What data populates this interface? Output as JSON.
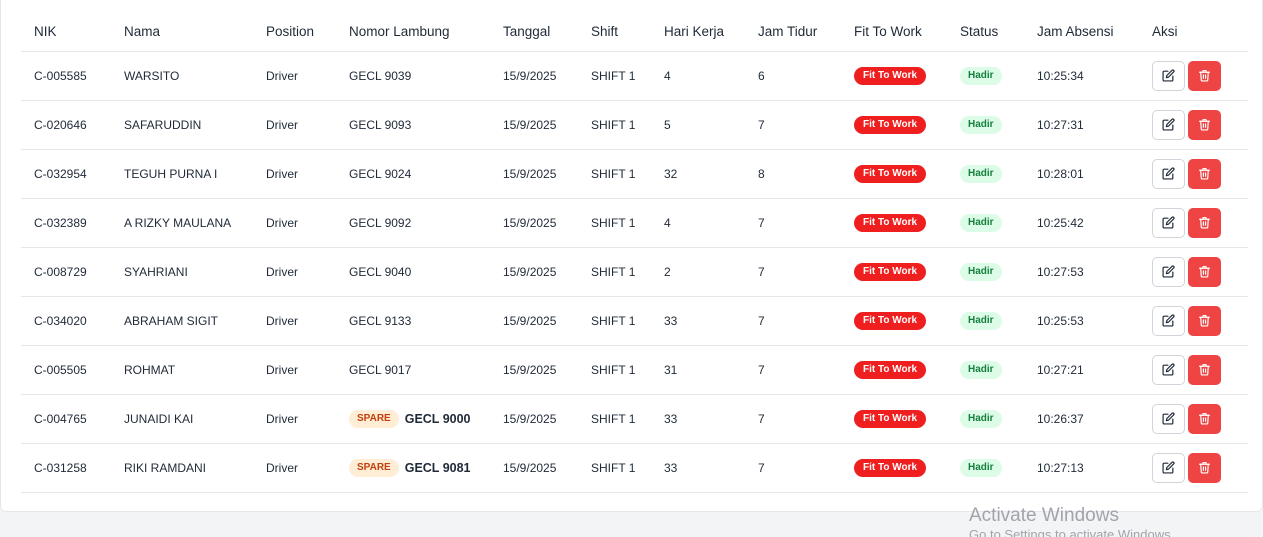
{
  "table": {
    "headers": [
      "NIK",
      "Nama",
      "Position",
      "Nomor Lambung",
      "Tanggal",
      "Shift",
      "Hari Kerja",
      "Jam Tidur",
      "Fit To Work",
      "Status",
      "Jam Absensi",
      "Aksi"
    ],
    "rows": [
      {
        "nik": "C-005585",
        "nama": "WARSITO",
        "position": "Driver",
        "spare": "",
        "lambung": "GECL 9039",
        "tanggal": "15/9/2025",
        "shift": "SHIFT 1",
        "hari_kerja": "4",
        "jam_tidur": "6",
        "fit": "Fit To Work",
        "status": "Hadir",
        "jam_absensi": "10:25:34"
      },
      {
        "nik": "C-020646",
        "nama": "SAFARUDDIN",
        "position": "Driver",
        "spare": "",
        "lambung": "GECL 9093",
        "tanggal": "15/9/2025",
        "shift": "SHIFT 1",
        "hari_kerja": "5",
        "jam_tidur": "7",
        "fit": "Fit To Work",
        "status": "Hadir",
        "jam_absensi": "10:27:31"
      },
      {
        "nik": "C-032954",
        "nama": "TEGUH PURNA I",
        "position": "Driver",
        "spare": "",
        "lambung": "GECL 9024",
        "tanggal": "15/9/2025",
        "shift": "SHIFT 1",
        "hari_kerja": "32",
        "jam_tidur": "8",
        "fit": "Fit To Work",
        "status": "Hadir",
        "jam_absensi": "10:28:01"
      },
      {
        "nik": "C-032389",
        "nama": "A RIZKY MAULANA",
        "position": "Driver",
        "spare": "",
        "lambung": "GECL 9092",
        "tanggal": "15/9/2025",
        "shift": "SHIFT 1",
        "hari_kerja": "4",
        "jam_tidur": "7",
        "fit": "Fit To Work",
        "status": "Hadir",
        "jam_absensi": "10:25:42"
      },
      {
        "nik": "C-008729",
        "nama": "SYAHRIANI",
        "position": "Driver",
        "spare": "",
        "lambung": "GECL 9040",
        "tanggal": "15/9/2025",
        "shift": "SHIFT 1",
        "hari_kerja": "2",
        "jam_tidur": "7",
        "fit": "Fit To Work",
        "status": "Hadir",
        "jam_absensi": "10:27:53"
      },
      {
        "nik": "C-034020",
        "nama": "ABRAHAM SIGIT",
        "position": "Driver",
        "spare": "",
        "lambung": "GECL 9133",
        "tanggal": "15/9/2025",
        "shift": "SHIFT 1",
        "hari_kerja": "33",
        "jam_tidur": "7",
        "fit": "Fit To Work",
        "status": "Hadir",
        "jam_absensi": "10:25:53"
      },
      {
        "nik": "C-005505",
        "nama": "ROHMAT",
        "position": "Driver",
        "spare": "",
        "lambung": "GECL 9017",
        "tanggal": "15/9/2025",
        "shift": "SHIFT 1",
        "hari_kerja": "31",
        "jam_tidur": "7",
        "fit": "Fit To Work",
        "status": "Hadir",
        "jam_absensi": "10:27:21"
      },
      {
        "nik": "C-004765",
        "nama": "JUNAIDI KAI",
        "position": "Driver",
        "spare": "SPARE",
        "lambung": "GECL 9000",
        "tanggal": "15/9/2025",
        "shift": "SHIFT 1",
        "hari_kerja": "33",
        "jam_tidur": "7",
        "fit": "Fit To Work",
        "status": "Hadir",
        "jam_absensi": "10:26:37"
      },
      {
        "nik": "C-031258",
        "nama": "RIKI RAMDANI",
        "position": "Driver",
        "spare": "SPARE",
        "lambung": "GECL 9081",
        "tanggal": "15/9/2025",
        "shift": "SHIFT 1",
        "hari_kerja": "33",
        "jam_tidur": "7",
        "fit": "Fit To Work",
        "status": "Hadir",
        "jam_absensi": "10:27:13"
      }
    ],
    "actions": {
      "edit_icon": "edit-icon",
      "delete_icon": "trash-icon"
    }
  },
  "watermark": {
    "title": "Activate Windows",
    "subtitle": "Go to Settings to activate Windows."
  },
  "colors": {
    "fit_badge": "#ef1f1f",
    "hadir_badge_bg": "#dcfce7",
    "hadir_badge_text": "#15803d",
    "spare_badge_bg": "#ffedd5",
    "spare_badge_text": "#c2410c",
    "delete_button": "#ef4444"
  }
}
